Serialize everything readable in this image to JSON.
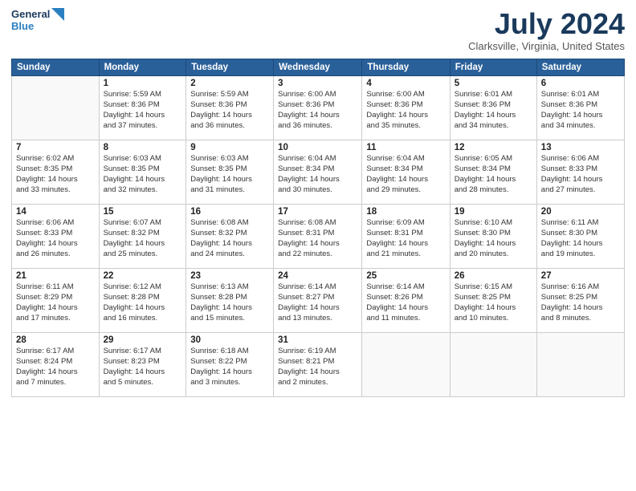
{
  "header": {
    "logo_line1": "General",
    "logo_line2": "Blue",
    "main_title": "July 2024",
    "subtitle": "Clarksville, Virginia, United States"
  },
  "days_of_week": [
    "Sunday",
    "Monday",
    "Tuesday",
    "Wednesday",
    "Thursday",
    "Friday",
    "Saturday"
  ],
  "weeks": [
    [
      {
        "day": "",
        "info": ""
      },
      {
        "day": "1",
        "info": "Sunrise: 5:59 AM\nSunset: 8:36 PM\nDaylight: 14 hours\nand 37 minutes."
      },
      {
        "day": "2",
        "info": "Sunrise: 5:59 AM\nSunset: 8:36 PM\nDaylight: 14 hours\nand 36 minutes."
      },
      {
        "day": "3",
        "info": "Sunrise: 6:00 AM\nSunset: 8:36 PM\nDaylight: 14 hours\nand 36 minutes."
      },
      {
        "day": "4",
        "info": "Sunrise: 6:00 AM\nSunset: 8:36 PM\nDaylight: 14 hours\nand 35 minutes."
      },
      {
        "day": "5",
        "info": "Sunrise: 6:01 AM\nSunset: 8:36 PM\nDaylight: 14 hours\nand 34 minutes."
      },
      {
        "day": "6",
        "info": "Sunrise: 6:01 AM\nSunset: 8:36 PM\nDaylight: 14 hours\nand 34 minutes."
      }
    ],
    [
      {
        "day": "7",
        "info": "Sunrise: 6:02 AM\nSunset: 8:35 PM\nDaylight: 14 hours\nand 33 minutes."
      },
      {
        "day": "8",
        "info": "Sunrise: 6:03 AM\nSunset: 8:35 PM\nDaylight: 14 hours\nand 32 minutes."
      },
      {
        "day": "9",
        "info": "Sunrise: 6:03 AM\nSunset: 8:35 PM\nDaylight: 14 hours\nand 31 minutes."
      },
      {
        "day": "10",
        "info": "Sunrise: 6:04 AM\nSunset: 8:34 PM\nDaylight: 14 hours\nand 30 minutes."
      },
      {
        "day": "11",
        "info": "Sunrise: 6:04 AM\nSunset: 8:34 PM\nDaylight: 14 hours\nand 29 minutes."
      },
      {
        "day": "12",
        "info": "Sunrise: 6:05 AM\nSunset: 8:34 PM\nDaylight: 14 hours\nand 28 minutes."
      },
      {
        "day": "13",
        "info": "Sunrise: 6:06 AM\nSunset: 8:33 PM\nDaylight: 14 hours\nand 27 minutes."
      }
    ],
    [
      {
        "day": "14",
        "info": "Sunrise: 6:06 AM\nSunset: 8:33 PM\nDaylight: 14 hours\nand 26 minutes."
      },
      {
        "day": "15",
        "info": "Sunrise: 6:07 AM\nSunset: 8:32 PM\nDaylight: 14 hours\nand 25 minutes."
      },
      {
        "day": "16",
        "info": "Sunrise: 6:08 AM\nSunset: 8:32 PM\nDaylight: 14 hours\nand 24 minutes."
      },
      {
        "day": "17",
        "info": "Sunrise: 6:08 AM\nSunset: 8:31 PM\nDaylight: 14 hours\nand 22 minutes."
      },
      {
        "day": "18",
        "info": "Sunrise: 6:09 AM\nSunset: 8:31 PM\nDaylight: 14 hours\nand 21 minutes."
      },
      {
        "day": "19",
        "info": "Sunrise: 6:10 AM\nSunset: 8:30 PM\nDaylight: 14 hours\nand 20 minutes."
      },
      {
        "day": "20",
        "info": "Sunrise: 6:11 AM\nSunset: 8:30 PM\nDaylight: 14 hours\nand 19 minutes."
      }
    ],
    [
      {
        "day": "21",
        "info": "Sunrise: 6:11 AM\nSunset: 8:29 PM\nDaylight: 14 hours\nand 17 minutes."
      },
      {
        "day": "22",
        "info": "Sunrise: 6:12 AM\nSunset: 8:28 PM\nDaylight: 14 hours\nand 16 minutes."
      },
      {
        "day": "23",
        "info": "Sunrise: 6:13 AM\nSunset: 8:28 PM\nDaylight: 14 hours\nand 15 minutes."
      },
      {
        "day": "24",
        "info": "Sunrise: 6:14 AM\nSunset: 8:27 PM\nDaylight: 14 hours\nand 13 minutes."
      },
      {
        "day": "25",
        "info": "Sunrise: 6:14 AM\nSunset: 8:26 PM\nDaylight: 14 hours\nand 11 minutes."
      },
      {
        "day": "26",
        "info": "Sunrise: 6:15 AM\nSunset: 8:25 PM\nDaylight: 14 hours\nand 10 minutes."
      },
      {
        "day": "27",
        "info": "Sunrise: 6:16 AM\nSunset: 8:25 PM\nDaylight: 14 hours\nand 8 minutes."
      }
    ],
    [
      {
        "day": "28",
        "info": "Sunrise: 6:17 AM\nSunset: 8:24 PM\nDaylight: 14 hours\nand 7 minutes."
      },
      {
        "day": "29",
        "info": "Sunrise: 6:17 AM\nSunset: 8:23 PM\nDaylight: 14 hours\nand 5 minutes."
      },
      {
        "day": "30",
        "info": "Sunrise: 6:18 AM\nSunset: 8:22 PM\nDaylight: 14 hours\nand 3 minutes."
      },
      {
        "day": "31",
        "info": "Sunrise: 6:19 AM\nSunset: 8:21 PM\nDaylight: 14 hours\nand 2 minutes."
      },
      {
        "day": "",
        "info": ""
      },
      {
        "day": "",
        "info": ""
      },
      {
        "day": "",
        "info": ""
      }
    ]
  ]
}
